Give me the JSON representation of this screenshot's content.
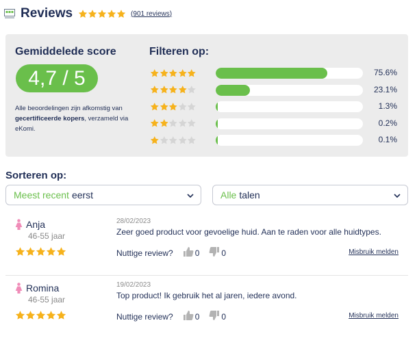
{
  "header": {
    "title": "Reviews",
    "rating_stars": 5,
    "review_count_open": "(",
    "review_count_link": "901 reviews",
    "review_count_close": ")"
  },
  "summary": {
    "title": "Gemiddelede score",
    "score": "4,7 / 5",
    "note_part1": "Alle beoordelingen zijn afkomstig van ",
    "note_bold": "gecertificeerde kopers",
    "note_part2": ", verzameld via eKomi."
  },
  "filter": {
    "title": "Filteren op:",
    "rows": [
      {
        "stars": 5,
        "fraction": 0.756,
        "pct": "75.6%"
      },
      {
        "stars": 4,
        "fraction": 0.231,
        "pct": "23.1%"
      },
      {
        "stars": 3,
        "fraction": 0.013,
        "pct": "1.3%"
      },
      {
        "stars": 2,
        "fraction": 0.002,
        "pct": "0.2%"
      },
      {
        "stars": 1,
        "fraction": 0.001,
        "pct": "0.1%"
      }
    ]
  },
  "sort": {
    "title": "Sorteren op:",
    "order_select": {
      "highlight": "Meest recent",
      "rest": "eerst"
    },
    "language_select": {
      "highlight": "Alle",
      "rest": "talen"
    }
  },
  "reviews": [
    {
      "name": "Anja",
      "age": "46-55 jaar",
      "stars": 5,
      "date": "28/02/2023",
      "text": "Zeer goed product voor gevoelige huid. Aan te raden voor alle huidtypes.",
      "useful_label": "Nuttige review?",
      "up": "0",
      "down": "0",
      "report": "Misbruik melden"
    },
    {
      "name": "Romina",
      "age": "46-55 jaar",
      "stars": 5,
      "date": "19/02/2023",
      "text": "Top product! Ik gebruik het al jaren, iedere avond.",
      "useful_label": "Nuttige review?",
      "up": "0",
      "down": "0",
      "report": "Misbruik melden"
    }
  ],
  "colors": {
    "accent_green": "#6abf4b",
    "star_gold": "#f6b21c",
    "star_empty": "#d5d5d5",
    "navy": "#1f2d55",
    "panel_bg": "#ececec",
    "female_icon": "#f08cb8"
  }
}
